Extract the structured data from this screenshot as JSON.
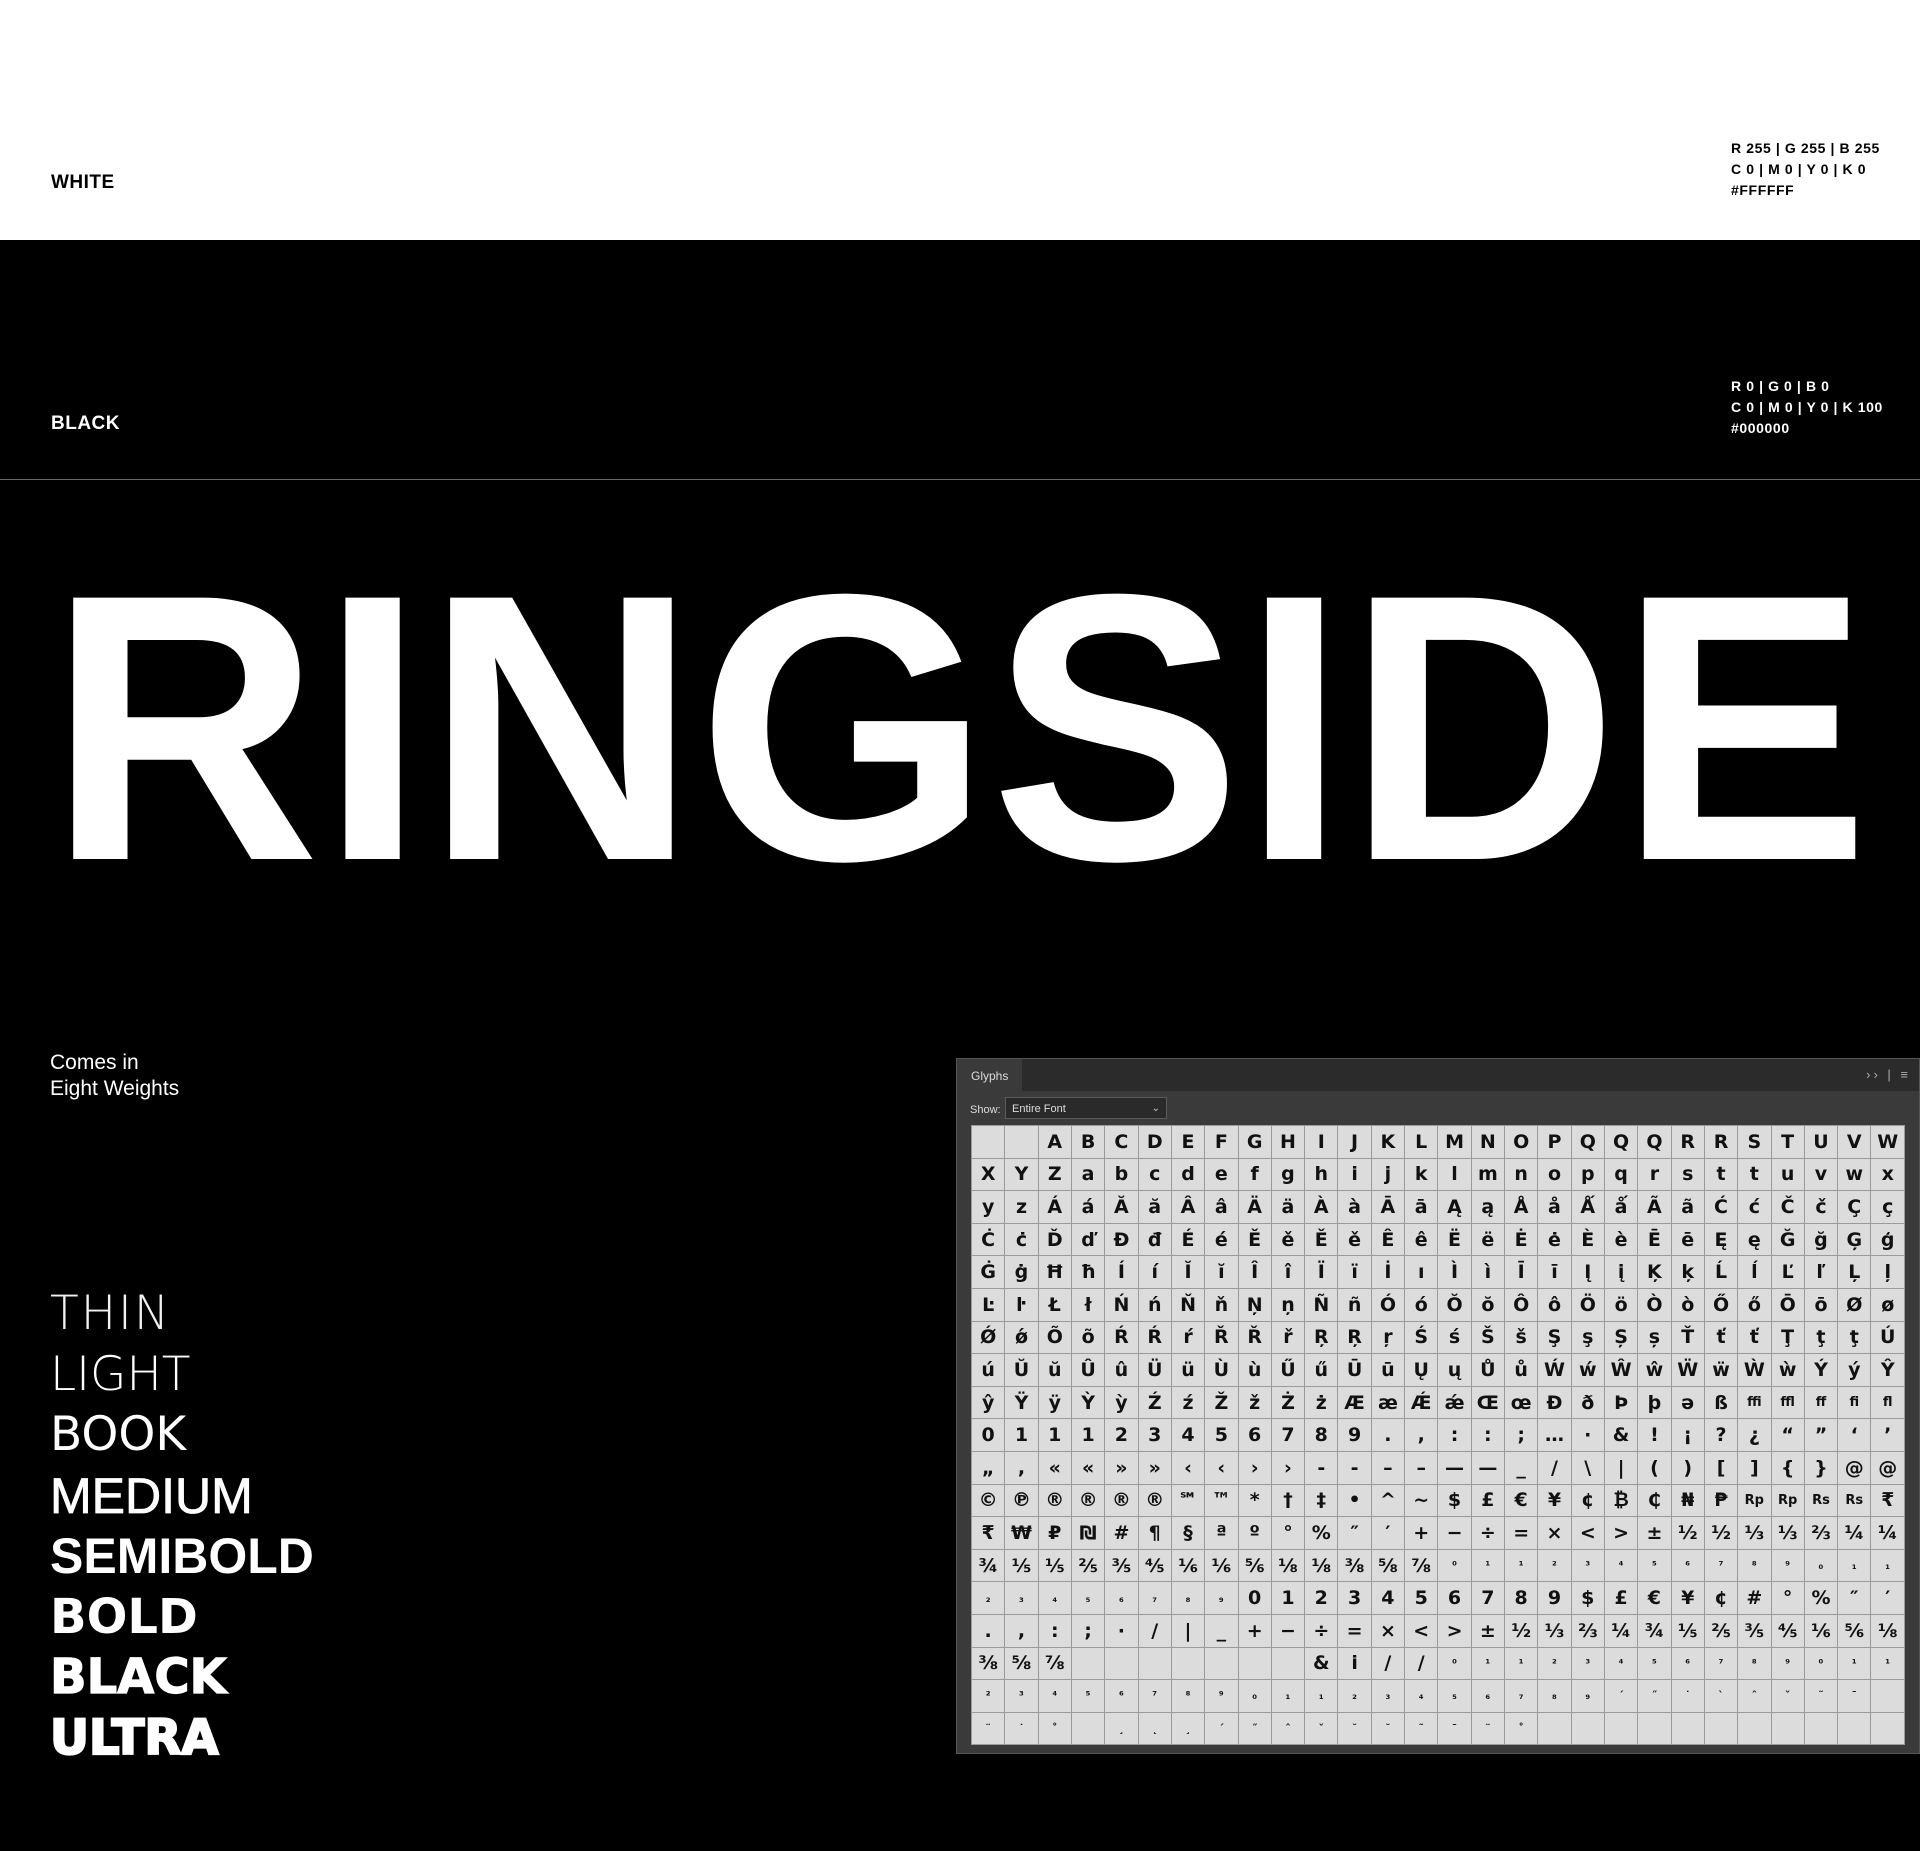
{
  "swatches": {
    "white": {
      "name": "WHITE",
      "hex_color": "#FFFFFF",
      "codes": [
        "R 255 | G 255 | B 255",
        "C 0 | M 0 | Y 0 | K 0",
        "#FFFFFF"
      ]
    },
    "black": {
      "name": "BLACK",
      "hex_color": "#000000",
      "codes": [
        "R 0 | G 0 | B 0",
        "C 0 | M 0 | Y 0 | K 100",
        "#000000"
      ]
    }
  },
  "hero": {
    "wordmark": "RINGSIDE"
  },
  "intro": {
    "line1": "Comes in",
    "line2": "Eight Weights"
  },
  "weights": [
    "THIN",
    "LIGHT",
    "BOOK",
    "MEDIUM",
    "SEMIBOLD",
    "BOLD",
    "BLACK",
    "ULTRA"
  ],
  "glyphs_panel": {
    "tab": "Glyphs",
    "controls": "›› | ≡",
    "show_label": "Show:",
    "show_value": "Entire Font",
    "rows": [
      [
        "",
        "",
        "A",
        "B",
        "C",
        "D",
        "E",
        "F",
        "G",
        "H",
        "I",
        "J",
        "K",
        "L",
        "M",
        "N",
        "O",
        "P",
        "Q",
        "Q",
        "Q",
        "R",
        "R",
        "S",
        "T",
        "U",
        "V",
        "W"
      ],
      [
        "X",
        "Y",
        "Z",
        "a",
        "b",
        "c",
        "d",
        "e",
        "f",
        "g",
        "h",
        "i",
        "j",
        "k",
        "l",
        "m",
        "n",
        "o",
        "p",
        "q",
        "r",
        "s",
        "t",
        "t",
        "u",
        "v",
        "w",
        "x"
      ],
      [
        "y",
        "z",
        "Á",
        "á",
        "Ă",
        "ă",
        "Â",
        "â",
        "Ä",
        "ä",
        "À",
        "à",
        "Ā",
        "ā",
        "Ą",
        "ą",
        "Å",
        "å",
        "Ǻ",
        "ǻ",
        "Ã",
        "ã",
        "Ć",
        "ć",
        "Č",
        "č",
        "Ç",
        "ç"
      ],
      [
        "Ċ",
        "ċ",
        "Ď",
        "ď",
        "Đ",
        "đ",
        "É",
        "é",
        "Ě",
        "ě",
        "Ě",
        "ě",
        "Ê",
        "ê",
        "Ë",
        "ë",
        "Ė",
        "ė",
        "È",
        "è",
        "Ē",
        "ē",
        "Ę",
        "ę",
        "Ğ",
        "ğ",
        "Ģ",
        "ģ"
      ],
      [
        "Ġ",
        "ġ",
        "Ħ",
        "ħ",
        "Í",
        "í",
        "Ĭ",
        "ĭ",
        "Î",
        "î",
        "Ï",
        "ï",
        "İ",
        "ı",
        "Ì",
        "ì",
        "Ī",
        "ī",
        "Į",
        "į",
        "Ķ",
        "ķ",
        "Ĺ",
        "ĺ",
        "Ľ",
        "ľ",
        "Ļ",
        "ļ"
      ],
      [
        "Ŀ",
        "ŀ",
        "Ł",
        "ł",
        "Ń",
        "ń",
        "Ň",
        "ň",
        "Ņ",
        "ņ",
        "Ñ",
        "ñ",
        "Ó",
        "ó",
        "Ŏ",
        "ŏ",
        "Ô",
        "ô",
        "Ö",
        "ö",
        "Ò",
        "ò",
        "Ő",
        "ő",
        "Ō",
        "ō",
        "Ø",
        "ø"
      ],
      [
        "Ǿ",
        "ǿ",
        "Õ",
        "õ",
        "Ŕ",
        "Ŕ",
        "ŕ",
        "Ř",
        "Ř",
        "ř",
        "Ŗ",
        "Ŗ",
        "ŗ",
        "Ś",
        "ś",
        "Š",
        "š",
        "Ş",
        "ş",
        "Ș",
        "ș",
        "Ť",
        "ť",
        "ť",
        "Ţ",
        "ţ",
        "ţ",
        "Ú"
      ],
      [
        "ú",
        "Ŭ",
        "ŭ",
        "Û",
        "û",
        "Ü",
        "ü",
        "Ù",
        "ù",
        "Ű",
        "ű",
        "Ū",
        "ū",
        "Ų",
        "ų",
        "Ů",
        "ů",
        "Ẃ",
        "ẃ",
        "Ŵ",
        "ŵ",
        "Ẅ",
        "ẅ",
        "Ẁ",
        "ẁ",
        "Ý",
        "ý",
        "Ŷ"
      ],
      [
        "ŷ",
        "Ÿ",
        "ÿ",
        "Ỳ",
        "ỳ",
        "Ź",
        "ź",
        "Ž",
        "ž",
        "Ż",
        "ż",
        "Æ",
        "æ",
        "Ǽ",
        "ǽ",
        "Œ",
        "œ",
        "Ð",
        "ð",
        "Þ",
        "þ",
        "ə",
        "ß",
        "ffi",
        "ffl",
        "ff",
        "fi",
        "fl"
      ],
      [
        "0",
        "1",
        "1",
        "1",
        "2",
        "3",
        "4",
        "5",
        "6",
        "7",
        "8",
        "9",
        ".",
        ",",
        ":",
        ":",
        ";",
        "…",
        "·",
        "&",
        "!",
        "¡",
        "?",
        "¿",
        "“",
        "”",
        "‘",
        "’"
      ],
      [
        "„",
        ",",
        "«",
        "«",
        "»",
        "»",
        "‹",
        "‹",
        "›",
        "›",
        "-",
        "-",
        "–",
        "–",
        "—",
        "—",
        "_",
        "/",
        "\\",
        "|",
        "(",
        ")",
        "[",
        "]",
        "{",
        "}",
        "@",
        "@"
      ],
      [
        "©",
        "℗",
        "®",
        "®",
        "®",
        "®",
        "℠",
        "™",
        "*",
        "†",
        "‡",
        "•",
        "^",
        "~",
        "$",
        "£",
        "€",
        "¥",
        "¢",
        "₿",
        "₵",
        "₦",
        "₱",
        "Rp",
        "Rp",
        "Rs",
        "Rs",
        "₹"
      ],
      [
        "₹",
        "₩",
        "₽",
        "₪",
        "#",
        "¶",
        "§",
        "ª",
        "º",
        "°",
        "%",
        "″",
        "′",
        "+",
        "−",
        "÷",
        "=",
        "×",
        "<",
        ">",
        "±",
        "½",
        "½",
        "⅓",
        "⅓",
        "⅔",
        "¼",
        "¼"
      ],
      [
        "¾",
        "⅕",
        "⅕",
        "⅖",
        "⅗",
        "⅘",
        "⅙",
        "⅙",
        "⅚",
        "⅛",
        "⅛",
        "⅜",
        "⅝",
        "⅞",
        "⁰",
        "¹",
        "¹",
        "²",
        "³",
        "⁴",
        "⁵",
        "⁶",
        "⁷",
        "⁸",
        "⁹",
        "₀",
        "₁",
        "₁"
      ],
      [
        "₂",
        "₃",
        "₄",
        "₅",
        "₆",
        "₇",
        "₈",
        "₉",
        "0",
        "1",
        "2",
        "3",
        "4",
        "5",
        "6",
        "7",
        "8",
        "9",
        "$",
        "£",
        "€",
        "¥",
        "¢",
        "#",
        "°",
        "%",
        "″",
        "′"
      ],
      [
        ".",
        ",",
        ":",
        ";",
        "·",
        "/",
        "|",
        "_",
        "+",
        "−",
        "÷",
        "=",
        "×",
        "<",
        ">",
        "±",
        "½",
        "⅓",
        "⅔",
        "¼",
        "¾",
        "⅕",
        "⅖",
        "⅗",
        "⅘",
        "⅙",
        "⅚",
        "⅛"
      ],
      [
        "⅜",
        "⅝",
        "⅞",
        "",
        "",
        "",
        "",
        "",
        "",
        "",
        "&",
        "i",
        "/",
        "/",
        "⁰",
        "¹",
        "¹",
        "²",
        "³",
        "⁴",
        "⁵",
        "⁶",
        "⁷",
        "⁸",
        "⁹",
        "⁰",
        "¹",
        "¹"
      ],
      [
        "²",
        "³",
        "⁴",
        "⁵",
        "⁶",
        "⁷",
        "⁸",
        "⁹",
        "₀",
        "₁",
        "₁",
        "₂",
        "₃",
        "₄",
        "₅",
        "₆",
        "₇",
        "₈",
        "₉",
        "´",
        "˝",
        "˙",
        "`",
        "ˆ",
        "ˇ",
        "˜",
        "¯",
        ""
      ],
      [
        "¨",
        "˙",
        "˚",
        "",
        "¸",
        "˛",
        "¸",
        "´",
        "˝",
        "ˆ",
        "ˇ",
        "˘",
        "˘",
        "˜",
        "¯",
        "¨",
        "˚",
        "",
        "",
        "",
        "",
        "",
        "",
        "",
        "",
        "",
        "",
        ""
      ]
    ]
  }
}
